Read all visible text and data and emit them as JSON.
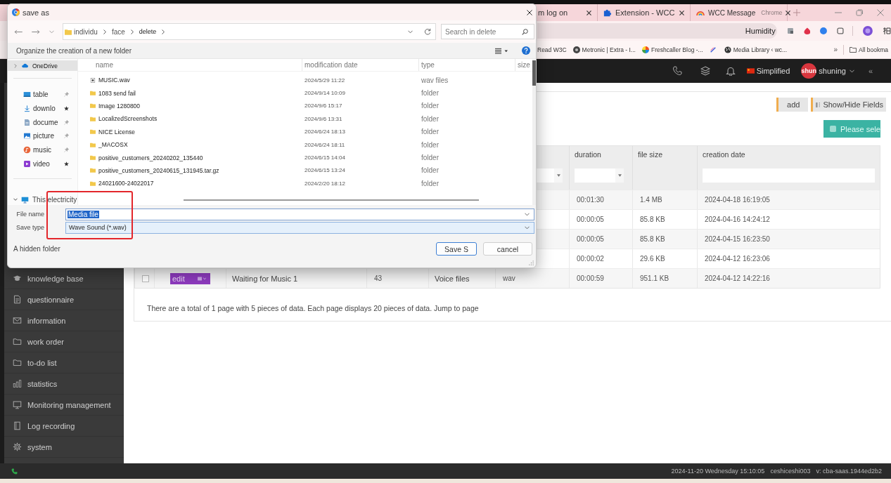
{
  "browser": {
    "tabs": [
      {
        "title": "m log on",
        "selected": false
      },
      {
        "title": "Extension - WCC",
        "selected": false
      },
      {
        "title": "WCC Message",
        "badge": "Chrome",
        "selected": false
      }
    ],
    "address_bar": {
      "text": "Humidity"
    },
    "bookmarks": [
      {
        "title": "Read W3C"
      },
      {
        "title": "Metronic | Extra - I..."
      },
      {
        "title": "Freshcaller Blog -..."
      },
      {
        "title": "Media Library ‹ wc..."
      }
    ],
    "more_bookmarks": "»",
    "all_bookmarks": "All bookma"
  },
  "header": {
    "language": "Simplified",
    "avatar": "shun",
    "user": "shuning",
    "collapse": "«"
  },
  "sidebar": {
    "items": [
      {
        "label": "knowledge base",
        "selected": false
      },
      {
        "label": "questionnaire",
        "selected": false
      },
      {
        "label": "information",
        "selected": false
      },
      {
        "label": "work order",
        "selected": false
      },
      {
        "label": "to-do list",
        "selected": false
      },
      {
        "label": "statistics",
        "selected": false
      },
      {
        "label": "Monitoring management",
        "selected": false
      },
      {
        "label": "Log recording",
        "selected": false
      },
      {
        "label": "system",
        "selected": false
      }
    ]
  },
  "content": {
    "toolbar": [
      {
        "label": "add"
      },
      {
        "label": "Show/Hide Fields"
      }
    ],
    "select_button": "Please sele",
    "table": {
      "columns": [
        {
          "kind": "select"
        },
        {
          "label": "duration",
          "kind": "select"
        },
        {
          "label": "file size",
          "kind": "plain"
        },
        {
          "label": "creation date",
          "kind": "text"
        }
      ],
      "rows": [
        {
          "duration": "00:01:30",
          "file_size": "1.4 MB",
          "creation_date": "2024-04-18 16:19:05"
        },
        {
          "duration": "00:00:05",
          "file_size": "85.8 KB",
          "creation_date": "2024-04-16 14:24:12"
        },
        {
          "duration": "00:00:05",
          "file_size": "85.8 KB",
          "creation_date": "2024-04-15 16:23:50"
        },
        {
          "duration": "00:00:02",
          "file_size": "29.6 KB",
          "creation_date": "2024-04-12 16:23:06"
        },
        {
          "checked": false,
          "action": "edit",
          "column_3": "Waiting for Music 1",
          "column_4": "43",
          "column_5": "Voice files",
          "column_6": "wav",
          "duration": "00:00:59",
          "file_size": "951.1 KB",
          "creation_date": "2024-04-12 14:22:16"
        }
      ]
    },
    "pagination": "There are a total of 1 page with 5 pieces of data. Each page displays 20 pieces of data. Jump to page"
  },
  "status_bar": {
    "datetime": "2024-11-20 Wednesday 15:10:05",
    "user": "ceshiceshi003",
    "version": "v: cba-saas.1944ed2b2"
  },
  "dialog": {
    "title": "save as",
    "path": [
      {
        "label": "individu"
      },
      {
        "label": "face"
      },
      {
        "label": "delete"
      }
    ],
    "search": {
      "placeholder": "Search in delete"
    },
    "command": "Organize the creation of a new folder",
    "nav": [
      {
        "label": "OneDrive",
        "kind": "tree",
        "expanded": false,
        "selected": true
      },
      {
        "label": "table",
        "kind": "quick",
        "starred": false,
        "selected": false
      },
      {
        "label": "downlo",
        "kind": "quick",
        "starred": true,
        "selected": false
      },
      {
        "label": "docume",
        "kind": "quick",
        "starred": false,
        "selected": false
      },
      {
        "label": "picture",
        "kind": "quick",
        "starred": false,
        "selected": false
      },
      {
        "label": "music",
        "kind": "quick",
        "starred": false,
        "selected": false
      },
      {
        "label": "video",
        "kind": "quick",
        "starred": true,
        "selected": false
      },
      {
        "label": "This electricity",
        "kind": "tree",
        "expanded": true,
        "selected": false
      }
    ],
    "columns": [
      "name",
      "modification date",
      "type",
      "size"
    ],
    "files": [
      {
        "name": "MUSIC.wav",
        "kind": "audio",
        "modified": "2024/5/29 11:22",
        "type": "wav files"
      },
      {
        "name": "1083 send fail",
        "kind": "folder",
        "modified": "2024/9/14 10:09",
        "type": "folder"
      },
      {
        "name": "Image 1280800",
        "kind": "folder",
        "modified": "2024/9/6 15:17",
        "type": "folder"
      },
      {
        "name": "LocalizedScreenshots",
        "kind": "folder",
        "modified": "2024/9/6 13:31",
        "type": "folder"
      },
      {
        "name": "NICE License",
        "kind": "folder",
        "modified": "2024/6/24 18:13",
        "type": "folder"
      },
      {
        "name": "_MACOSX",
        "kind": "folder",
        "modified": "2024/6/24 18:11",
        "type": "folder"
      },
      {
        "name": "positive_customers_20240202_135440",
        "kind": "folder",
        "modified": "2024/6/15 14:04",
        "type": "folder"
      },
      {
        "name": "positive_customers_20240615_131945.tar.gz",
        "kind": "folder",
        "modified": "2024/6/15 13:24",
        "type": "folder"
      },
      {
        "name": "24021600-24022017",
        "kind": "folder",
        "modified": "2024/2/20 18:12",
        "type": "folder"
      }
    ],
    "file_name": {
      "label": "File name",
      "value": "Media file",
      "selected": true
    },
    "save_type": {
      "label": "Save type",
      "value": "Wave Sound (*.wav)"
    },
    "hidden_folder": "A hidden folder",
    "buttons": [
      {
        "label": "Save S",
        "primary": true
      },
      {
        "label": "cancel",
        "primary": false
      }
    ]
  }
}
